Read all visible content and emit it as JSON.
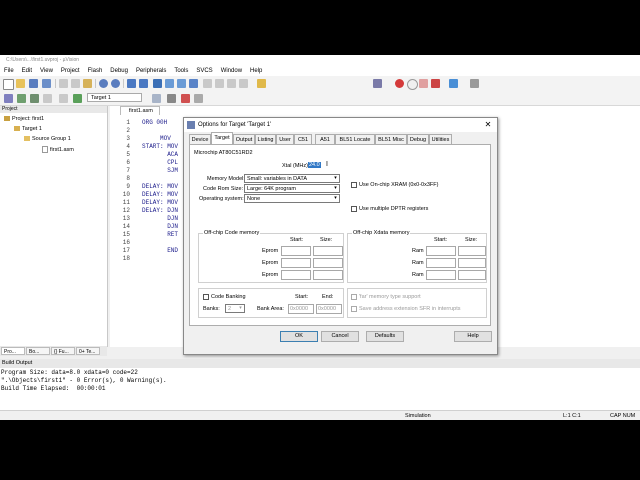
{
  "window": {
    "title": "C:\\Users\\...\\first1.uvproj - µVision"
  },
  "menu": [
    "File",
    "Edit",
    "View",
    "Project",
    "Flash",
    "Debug",
    "Peripherals",
    "Tools",
    "SVCS",
    "Window",
    "Help"
  ],
  "toolbar": {
    "target_select": "Target 1"
  },
  "project_panel": {
    "header": "Project",
    "tree": [
      {
        "label": "Project: first1",
        "level": 0
      },
      {
        "label": "Target 1",
        "level": 1
      },
      {
        "label": "Source Group 1",
        "level": 2
      },
      {
        "label": "first1.asm",
        "level": 3
      }
    ],
    "tabs": [
      "Pro...",
      "Bo...",
      "{} Fu...",
      "0+ Te..."
    ]
  },
  "editor": {
    "tab": "first1.asm",
    "line_numbers": [
      "1",
      "2",
      "3",
      "4",
      "5",
      "6",
      "7",
      "8",
      "9",
      "10",
      "11",
      "12",
      "13",
      "14",
      "15",
      "16",
      "17",
      "18"
    ],
    "code": [
      "ORG 00H",
      "",
      "     MOV",
      "START: MOV",
      "       ACA",
      "       CPL",
      "       SJM",
      "",
      "DELAY: MOV",
      "DELAY: MOV",
      "DELAY: MOV",
      "DELAY: DJN",
      "       DJN",
      "       DJN",
      "       RET",
      "",
      "       END",
      ""
    ]
  },
  "output": {
    "header": "Build Output",
    "lines": [
      "Program Size: data=8.0 xdata=0 code=22",
      "\".\\Objects\\first1\" - 0 Error(s), 0 Warning(s).",
      "Build Time Elapsed:  00:00:01"
    ]
  },
  "statusbar": {
    "mode": "Simulation",
    "position": "L:1 C:1",
    "caps": "CAP  NUM"
  },
  "dialog": {
    "title": "Options for Target 'Target 1'",
    "tabs": [
      "Device",
      "Target",
      "Output",
      "Listing",
      "User",
      "C51",
      "A51",
      "BL51 Locate",
      "BL51 Misc",
      "Debug",
      "Utilities"
    ],
    "selected_tab": "Target",
    "device": "Microchip AT80C51RD2",
    "xtal_label": "Xtal (MHz):",
    "xtal_value": "24.0",
    "memory_model_label": "Memory Model:",
    "memory_model": "Small: variables in DATA",
    "code_rom_label": "Code Rom Size:",
    "code_rom": "Large: 64K program",
    "os_label": "Operating system:",
    "os": "None",
    "onchip_xram": "Use On-chip XRAM (0x0-0x3FF)",
    "multiple_dptr": "Use multiple DPTR registers",
    "offchip_code": {
      "title": "Off-chip Code memory",
      "start_hdr": "Start:",
      "size_hdr": "Size:",
      "rows": [
        "Eprom",
        "Eprom",
        "Eprom"
      ]
    },
    "offchip_xdata": {
      "title": "Off-chip Xdata memory",
      "start_hdr": "Start:",
      "size_hdr": "Size:",
      "rows": [
        "Ram",
        "Ram",
        "Ram"
      ]
    },
    "code_banking": "Code Banking",
    "banks_label": "Banks:",
    "banks_value": "2",
    "bank_area_label": "Bank Area:",
    "bank_start_hdr": "Start:",
    "bank_end_hdr": "End:",
    "bank_start": "0x0000",
    "bank_end": "0x0000",
    "far_memory": "'far' memory type support",
    "save_address": "Save address extension SFR in interrupts",
    "buttons": {
      "ok": "OK",
      "cancel": "Cancel",
      "defaults": "Defaults",
      "help": "Help"
    }
  }
}
